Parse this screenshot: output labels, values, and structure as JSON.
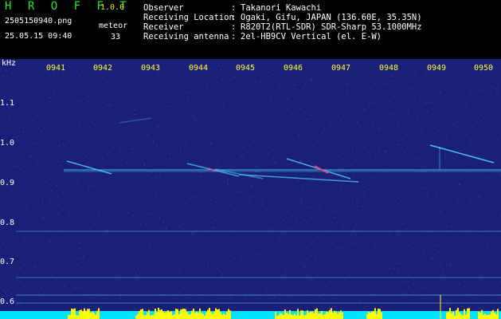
{
  "header": {
    "brand": "H R O F F T",
    "version": "1.0.0",
    "filename": "2505150940.png",
    "datetime": "25.05.15 09:40",
    "meteor_label": "meteor",
    "meteor_count": "33",
    "rows": [
      {
        "label": "Observer",
        "sep": ":",
        "value": "Takanori Kawachi"
      },
      {
        "label": "Receiving Location",
        "sep": ":",
        "value": "Ogaki, Gifu, JAPAN (136.60E, 35.35N)"
      },
      {
        "label": "Receiver",
        "sep": ":",
        "value": "R820T2(RTL-SDR) SDR-Sharp 53.1000MHz"
      },
      {
        "label": "Receiving antenna",
        "sep": ":",
        "value": "2el-HB9CV Vertical (el. E-W)"
      }
    ]
  },
  "spectrogram": {
    "y_unit": "kHz",
    "time_ticks": [
      "0941",
      "0942",
      "0943",
      "0944",
      "0945",
      "0946",
      "0947",
      "0948",
      "0949",
      "0950"
    ],
    "freq_ticks": [
      "1.1",
      "1.0",
      "0.9",
      "0.8",
      "0.7",
      "0.6"
    ],
    "colors": {
      "background": "#1a1f78",
      "noise": "#3b52d8",
      "trace": "#4fd0ff",
      "hot": "#ff3b7a",
      "signal_bar": "#00e5ff",
      "signal_peak": "#ffff00",
      "tick_label": "#ffff33",
      "brand": "#27e627"
    }
  }
}
